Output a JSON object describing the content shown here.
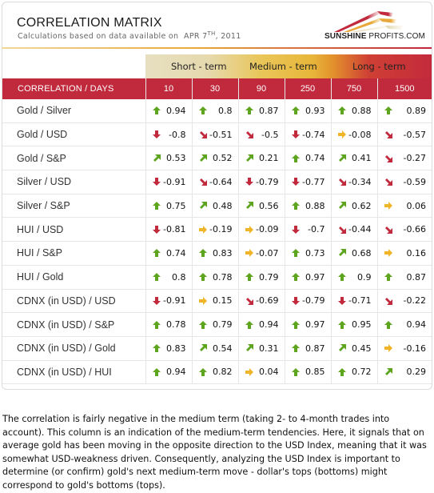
{
  "header": {
    "title": "CORRELATION MATRIX",
    "subtitle_prefix": "Calculations based on data available on",
    "date_month_day": "APR 7",
    "date_suffix": "TH",
    "date_year": ", 2011",
    "brand_bold": "SUNSHINE",
    "brand_rest": " PROFITS.COM",
    "brand_colors": {
      "red": "#c12a3d",
      "orange": "#e8a93a",
      "cream": "#f1d79a"
    }
  },
  "terms": [
    "Short - term",
    "Medium - term",
    "Long - term"
  ],
  "table": {
    "corner_label": "CORRELATION / DAYS",
    "columns": [
      "10",
      "30",
      "90",
      "250",
      "750",
      "1500"
    ],
    "rows": [
      {
        "label": "Gold / Silver",
        "cells": [
          {
            "v": "0.94",
            "a": "up"
          },
          {
            "v": "0.8",
            "a": "up"
          },
          {
            "v": "0.87",
            "a": "up"
          },
          {
            "v": "0.93",
            "a": "up"
          },
          {
            "v": "0.88",
            "a": "up"
          },
          {
            "v": "0.89",
            "a": "up"
          }
        ]
      },
      {
        "label": "Gold / USD",
        "cells": [
          {
            "v": "-0.8",
            "a": "down"
          },
          {
            "v": "-0.51",
            "a": "down-right"
          },
          {
            "v": "-0.5",
            "a": "down-right"
          },
          {
            "v": "-0.74",
            "a": "down"
          },
          {
            "v": "-0.08",
            "a": "right"
          },
          {
            "v": "-0.57",
            "a": "down-right"
          }
        ]
      },
      {
        "label": "Gold / S&P",
        "cells": [
          {
            "v": "0.53",
            "a": "up-right"
          },
          {
            "v": "0.52",
            "a": "up-right"
          },
          {
            "v": "0.21",
            "a": "up-right"
          },
          {
            "v": "0.74",
            "a": "up"
          },
          {
            "v": "0.41",
            "a": "up-right"
          },
          {
            "v": "-0.27",
            "a": "down-right"
          }
        ]
      },
      {
        "label": "Silver / USD",
        "cells": [
          {
            "v": "-0.91",
            "a": "down"
          },
          {
            "v": "-0.64",
            "a": "down-right"
          },
          {
            "v": "-0.79",
            "a": "down"
          },
          {
            "v": "-0.77",
            "a": "down"
          },
          {
            "v": "-0.34",
            "a": "down-right"
          },
          {
            "v": "-0.59",
            "a": "down-right"
          }
        ]
      },
      {
        "label": "Silver / S&P",
        "cells": [
          {
            "v": "0.75",
            "a": "up"
          },
          {
            "v": "0.48",
            "a": "up-right"
          },
          {
            "v": "0.56",
            "a": "up-right"
          },
          {
            "v": "0.88",
            "a": "up"
          },
          {
            "v": "0.62",
            "a": "up-right"
          },
          {
            "v": "0.06",
            "a": "right"
          }
        ]
      },
      {
        "label": "HUI / USD",
        "cells": [
          {
            "v": "-0.81",
            "a": "down"
          },
          {
            "v": "-0.19",
            "a": "right"
          },
          {
            "v": "-0.09",
            "a": "right"
          },
          {
            "v": "-0.7",
            "a": "down"
          },
          {
            "v": "-0.44",
            "a": "down-right"
          },
          {
            "v": "-0.66",
            "a": "down-right"
          }
        ]
      },
      {
        "label": "HUI / S&P",
        "cells": [
          {
            "v": "0.74",
            "a": "up"
          },
          {
            "v": "0.83",
            "a": "up"
          },
          {
            "v": "-0.07",
            "a": "right"
          },
          {
            "v": "0.73",
            "a": "up"
          },
          {
            "v": "0.68",
            "a": "up-right"
          },
          {
            "v": "0.16",
            "a": "right"
          }
        ]
      },
      {
        "label": "HUI / Gold",
        "cells": [
          {
            "v": "0.8",
            "a": "up"
          },
          {
            "v": "0.78",
            "a": "up"
          },
          {
            "v": "0.79",
            "a": "up"
          },
          {
            "v": "0.97",
            "a": "up"
          },
          {
            "v": "0.9",
            "a": "up"
          },
          {
            "v": "0.87",
            "a": "up"
          }
        ]
      },
      {
        "label": "CDNX (in USD) / USD",
        "cells": [
          {
            "v": "-0.91",
            "a": "down"
          },
          {
            "v": "0.15",
            "a": "right"
          },
          {
            "v": "-0.69",
            "a": "down-right"
          },
          {
            "v": "-0.79",
            "a": "down"
          },
          {
            "v": "-0.71",
            "a": "down"
          },
          {
            "v": "-0.22",
            "a": "down-right"
          }
        ]
      },
      {
        "label": "CDNX (in USD) / S&P",
        "cells": [
          {
            "v": "0.78",
            "a": "up"
          },
          {
            "v": "0.79",
            "a": "up"
          },
          {
            "v": "0.94",
            "a": "up"
          },
          {
            "v": "0.97",
            "a": "up"
          },
          {
            "v": "0.95",
            "a": "up"
          },
          {
            "v": "0.94",
            "a": "up"
          }
        ]
      },
      {
        "label": "CDNX (in USD) / Gold",
        "cells": [
          {
            "v": "0.83",
            "a": "up"
          },
          {
            "v": "0.54",
            "a": "up-right"
          },
          {
            "v": "0.31",
            "a": "up-right"
          },
          {
            "v": "0.87",
            "a": "up"
          },
          {
            "v": "0.45",
            "a": "up-right"
          },
          {
            "v": "-0.16",
            "a": "right"
          }
        ]
      },
      {
        "label": "CDNX (in USD) / HUI",
        "cells": [
          {
            "v": "0.94",
            "a": "up"
          },
          {
            "v": "0.82",
            "a": "up"
          },
          {
            "v": "0.04",
            "a": "right"
          },
          {
            "v": "0.85",
            "a": "up"
          },
          {
            "v": "0.72",
            "a": "up"
          },
          {
            "v": "0.29",
            "a": "up-right"
          }
        ]
      }
    ]
  },
  "arrow_icons": {
    "up": {
      "name": "arrow-up-icon",
      "color": "#5ea51f"
    },
    "up-right": {
      "name": "arrow-up-right-icon",
      "color": "#5ea51f"
    },
    "right": {
      "name": "arrow-right-icon",
      "color": "#f0b429"
    },
    "down-right": {
      "name": "arrow-down-right-icon",
      "color": "#c12a3d"
    },
    "down": {
      "name": "arrow-down-icon",
      "color": "#c12a3d"
    }
  },
  "footer": {
    "text": "The correlation is fairly negative in the medium term (taking 2- to 4-month trades into account). This column is an indication of the medium-term tendencies. Here, it signals that on average gold has been moving in the opposite direction to the USD Index, meaning that it was somewhat USD-weakness driven. Consequently, analyzing the USD Index is important to determine (or confirm) gold's next medium-term move - dollar's tops (bottoms) might correspond to gold's bottoms (tops)."
  }
}
